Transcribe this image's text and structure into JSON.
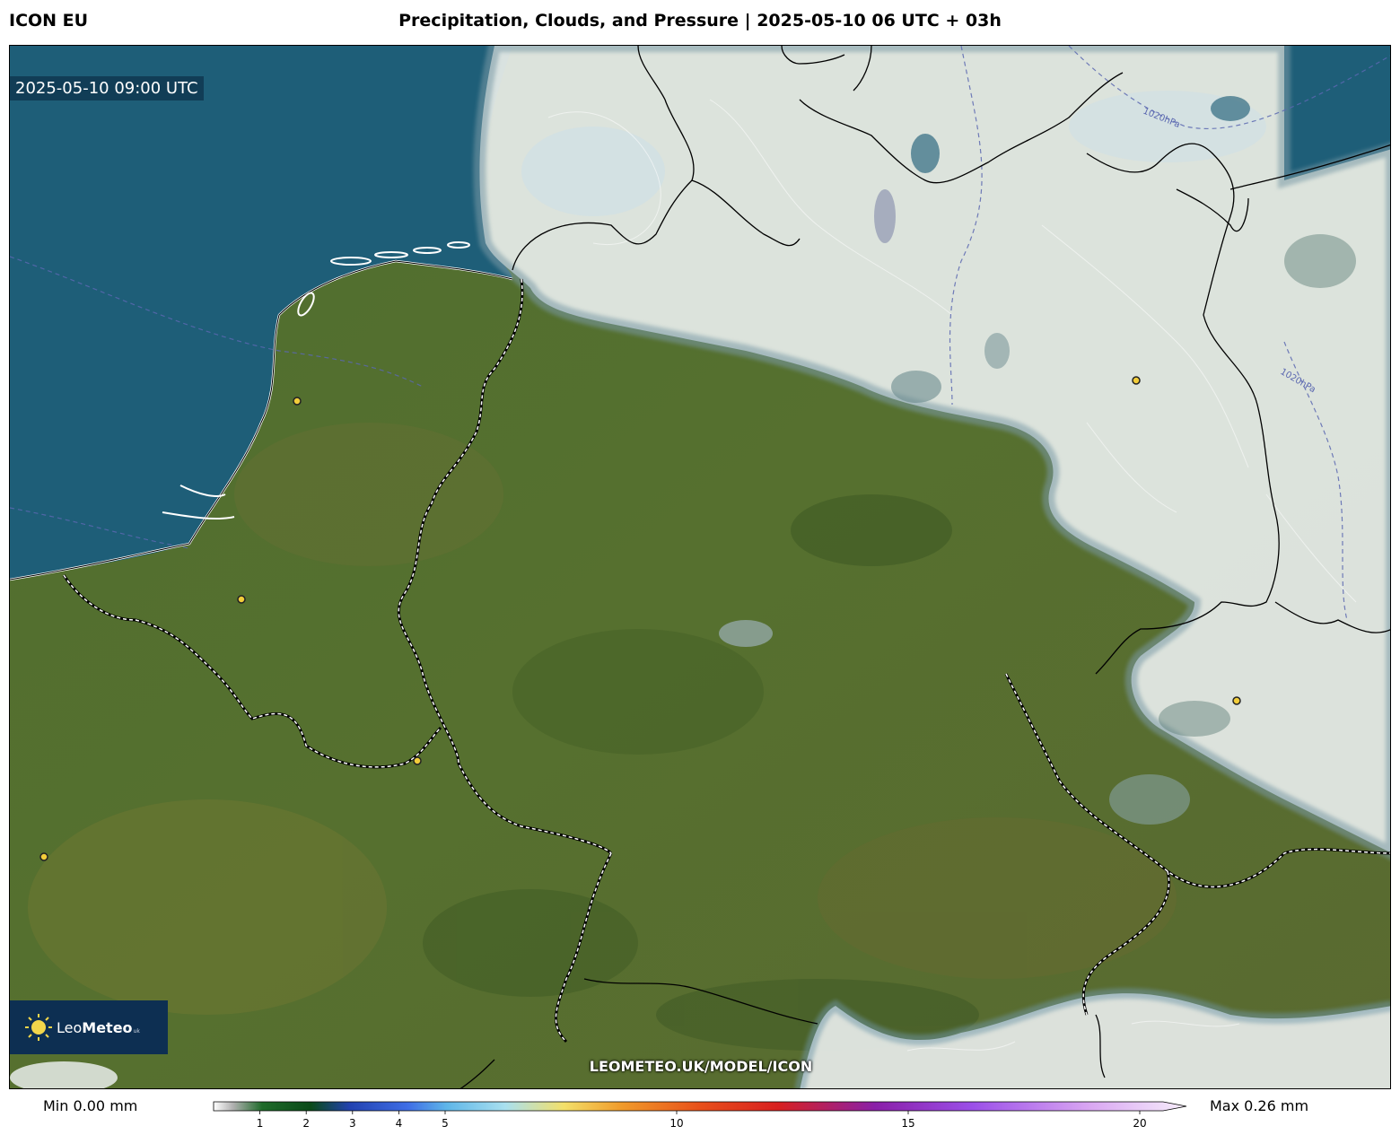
{
  "header": {
    "model": "ICON EU",
    "title": "Precipitation, Clouds, and Pressure | 2025-05-10 06 UTC + 03h"
  },
  "map": {
    "valid_time": "2025-05-10 09:00 UTC",
    "isobar_labels": [
      "1020hPa",
      "1020hPa"
    ],
    "watermark": "LEOMETEO.UK/MODEL/ICON",
    "logo": {
      "prefix": "Leo",
      "bold": "Meteo",
      "suffix": "uk"
    },
    "colors": {
      "sea": "#1e5e78",
      "land": "#4d6a2c",
      "cloud": "#e6ebe6",
      "isobar": "#5a67b0"
    }
  },
  "legend": {
    "min_label": "Min 0.00 mm",
    "max_label": "Max 0.26 mm",
    "ticks": [
      "1",
      "2",
      "3",
      "4",
      "5",
      "10",
      "15",
      "20"
    ]
  }
}
